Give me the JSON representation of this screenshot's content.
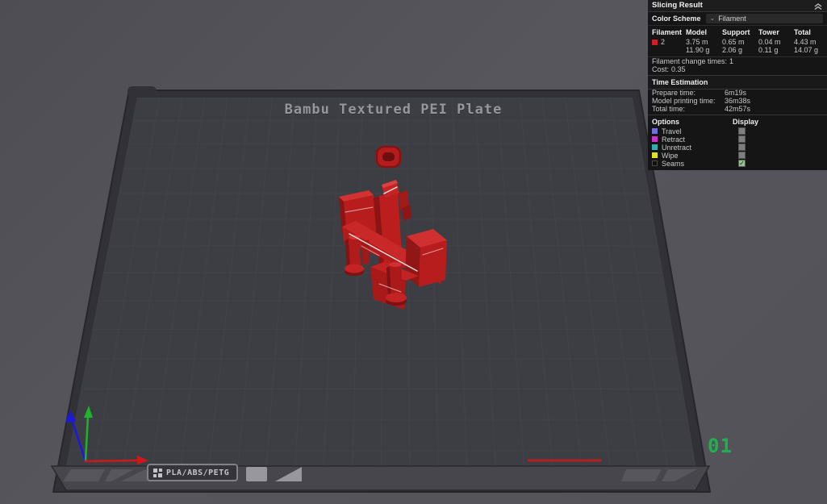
{
  "viewport": {
    "plate_label": "Bambu Textured PEI Plate",
    "plate_number": "01",
    "plate_tag": "PLA/ABS/PETG",
    "colors": {
      "model_red": "#b81d1d",
      "plate_surface": "#3d3d44",
      "plate_grid": "#47474f",
      "background": "#56565c",
      "plate_number_green": "#1fb150",
      "axis_x": "#d01818",
      "axis_y": "#1db32a",
      "axis_z": "#1a1adf"
    }
  },
  "panel": {
    "title": "Slicing Result",
    "color_scheme": {
      "label": "Color Scheme",
      "value": "Filament"
    },
    "filament_table": {
      "headers": [
        "Filament",
        "Model",
        "Support",
        "Tower",
        "Total"
      ],
      "rows": [
        {
          "filament": "2",
          "swatch_color": "#cc2025",
          "model_len": "3.75 m",
          "model_wt": "11.90 g",
          "support_len": "0.65 m",
          "support_wt": "2.06 g",
          "tower_len": "0.04 m",
          "tower_wt": "0.11 g",
          "total_len": "4.43 m",
          "total_wt": "14.07 g"
        }
      ]
    },
    "filament_change": {
      "label": "Filament change times:",
      "value": "1"
    },
    "cost": {
      "label": "Cost:",
      "value": "0.35"
    },
    "time_estimation": {
      "title": "Time Estimation",
      "rows": [
        {
          "label": "Prepare time:",
          "value": "6m19s"
        },
        {
          "label": "Model printing time:",
          "value": "36m38s"
        },
        {
          "label": "Total time:",
          "value": "42m57s"
        }
      ]
    },
    "options": {
      "title": "Options",
      "display_title": "Display",
      "items": [
        {
          "label": "Travel",
          "color": "#6e6edd",
          "checked": false
        },
        {
          "label": "Retract",
          "color": "#cc33cc",
          "checked": false
        },
        {
          "label": "Unretract",
          "color": "#2fb0b0",
          "checked": false
        },
        {
          "label": "Wipe",
          "color": "#e3e31a",
          "checked": false
        },
        {
          "label": "Seams",
          "color": "#101010",
          "checked": true
        }
      ]
    }
  }
}
